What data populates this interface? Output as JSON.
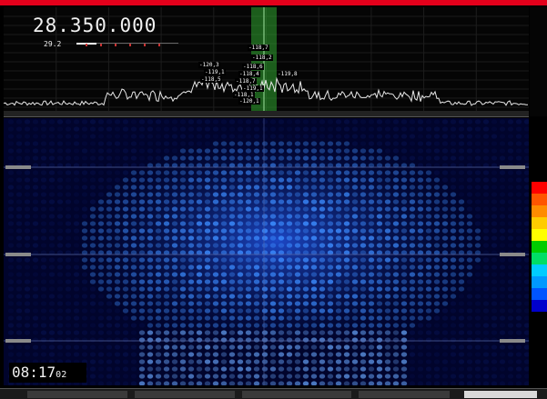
{
  "app": {
    "accent_color": "#e3001b"
  },
  "frequency": {
    "main": "28.350.000",
    "sub_lines": [
      "",
      ""
    ]
  },
  "smeter": {
    "value": "29.2"
  },
  "spectrum": {
    "passband_color": "#2fa52f",
    "peak_tags": [
      {
        "text": "-118,7"
      },
      {
        "text": "-118,2"
      },
      {
        "text": "-120,3"
      },
      {
        "text": "-118,6"
      },
      {
        "text": "-119,1"
      },
      {
        "text": "-118,4"
      },
      {
        "text": "-119,8"
      },
      {
        "text": "-118,5"
      },
      {
        "text": "-118,7"
      },
      {
        "text": "-119,1"
      },
      {
        "text": "-118,1"
      },
      {
        "text": "-120,1"
      }
    ]
  },
  "waterfall": {
    "signal_color": "#3c8cff",
    "background_color": "#01042c"
  },
  "color_legend": [
    "#ff0000",
    "#ff5500",
    "#ff8c00",
    "#ffcc00",
    "#ffff00",
    "#00cc00",
    "#00dd66",
    "#00ccff",
    "#0099ff",
    "#0055ff",
    "#0000cc"
  ],
  "clock": {
    "hm": "08:17",
    "sec": "02"
  }
}
